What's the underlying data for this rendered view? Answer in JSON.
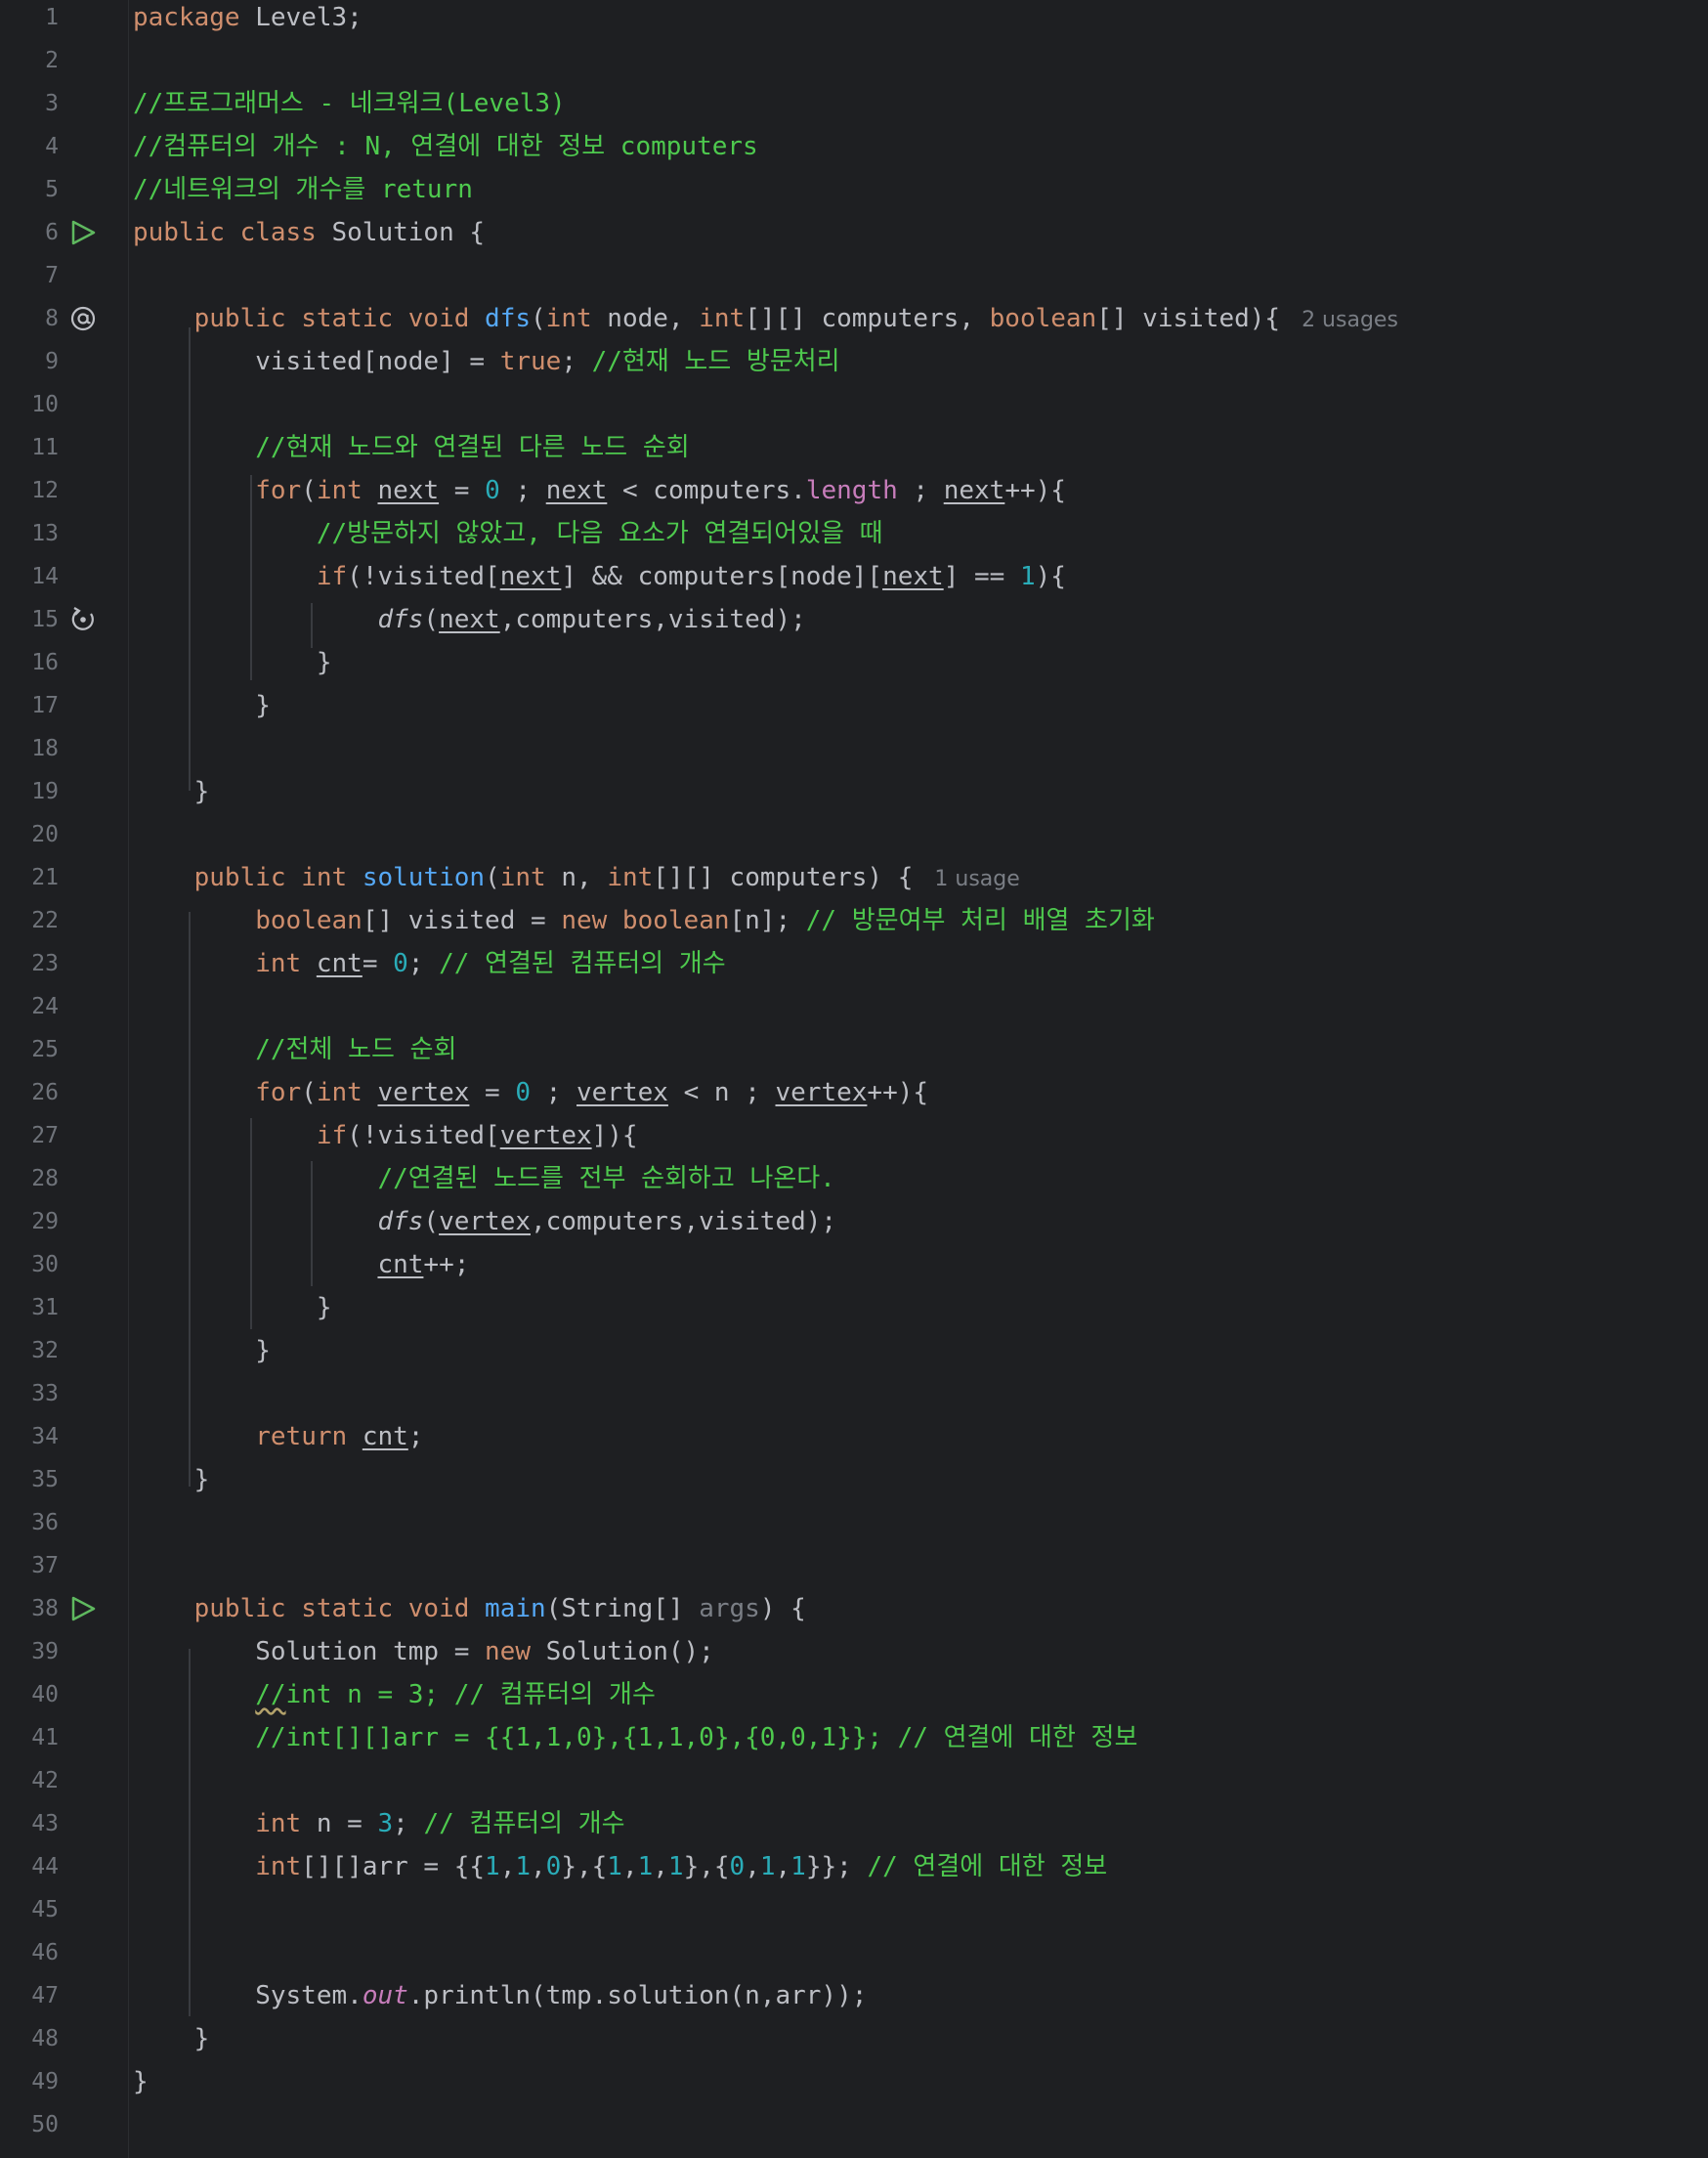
{
  "editor": {
    "line_numbers": [
      "1",
      "2",
      "3",
      "4",
      "5",
      "6",
      "7",
      "8",
      "9",
      "10",
      "11",
      "12",
      "13",
      "14",
      "15",
      "16",
      "17",
      "18",
      "19",
      "20",
      "21",
      "22",
      "23",
      "24",
      "25",
      "26",
      "27",
      "28",
      "29",
      "30",
      "31",
      "32",
      "33",
      "34",
      "35",
      "36",
      "37",
      "38",
      "39",
      "40",
      "41",
      "42",
      "43",
      "44",
      "45",
      "46",
      "47",
      "48",
      "49",
      "50"
    ],
    "gutter_icons": {
      "line6": "run-icon",
      "line8": "implemented-at-icon",
      "line15": "recursion-icon",
      "line38": "run-icon"
    },
    "inlay_hints": {
      "dfs_usages": "2 usages",
      "solution_usages": "1 usage"
    },
    "comments": {
      "c3": "//프로그래머스 - 네크워크(Level3)",
      "c4": "//컴퓨터의 개수 : N, 연결에 대한 정보 computers",
      "c5": "//네트워크의 개수를 return",
      "c9": "//현재 노드 방문처리",
      "c11": "//현재 노드와 연결된 다른 노드 순회",
      "c13": "//방문하지 않았고, 다음 요소가 연결되어있을 때",
      "c22": "// 방문여부 처리 배열 초기화",
      "c23": "// 연결된 컴퓨터의 개수",
      "c25": "//전체 노드 순회",
      "c28": "//연결된 노드를 전부 순회하고 나온다.",
      "c40a": "//",
      "c40b": "int n = 3; // 컴퓨터의 개수",
      "c41": "//int[][]arr = {{1,1,0},{1,1,0},{0,0,1}}; // 연결에 대한 정보",
      "c43": "// 컴퓨터의 개수",
      "c44": "// 연결에 대한 정보"
    },
    "colors": {
      "background": "#1e1f22",
      "keyword": "#cf8e6d",
      "function": "#56a8f5",
      "number": "#2aacb8",
      "comment": "#4ec94e",
      "field": "#c77dbb",
      "text": "#bcbec4",
      "line_number": "#6f737a"
    }
  }
}
